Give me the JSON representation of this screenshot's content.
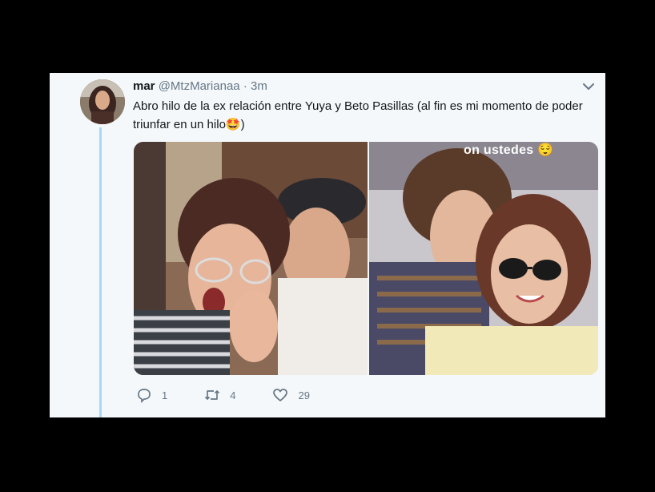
{
  "tweet": {
    "display_name": "mar",
    "handle": "@MtzMarianaa",
    "separator": "·",
    "time": "3m",
    "text": "Abro hilo de la ex relación entre Yuya y Beto Pasillas (al fin es mi momento de poder triunfar en un hilo",
    "emoji": "🤩",
    "text_end": ")"
  },
  "media": {
    "photo_right_caption": "on ustedes",
    "caption_emoji": "😌"
  },
  "actions": {
    "reply_count": "1",
    "retweet_count": "4",
    "like_count": "29"
  },
  "colors": {
    "background": "#000000",
    "card": "#f5f8fa",
    "thread_line": "#a7d8f6",
    "muted": "#657786"
  },
  "icons": {
    "reply": "reply-icon",
    "retweet": "retweet-icon",
    "like": "heart-icon",
    "menu": "chevron-down-icon"
  }
}
